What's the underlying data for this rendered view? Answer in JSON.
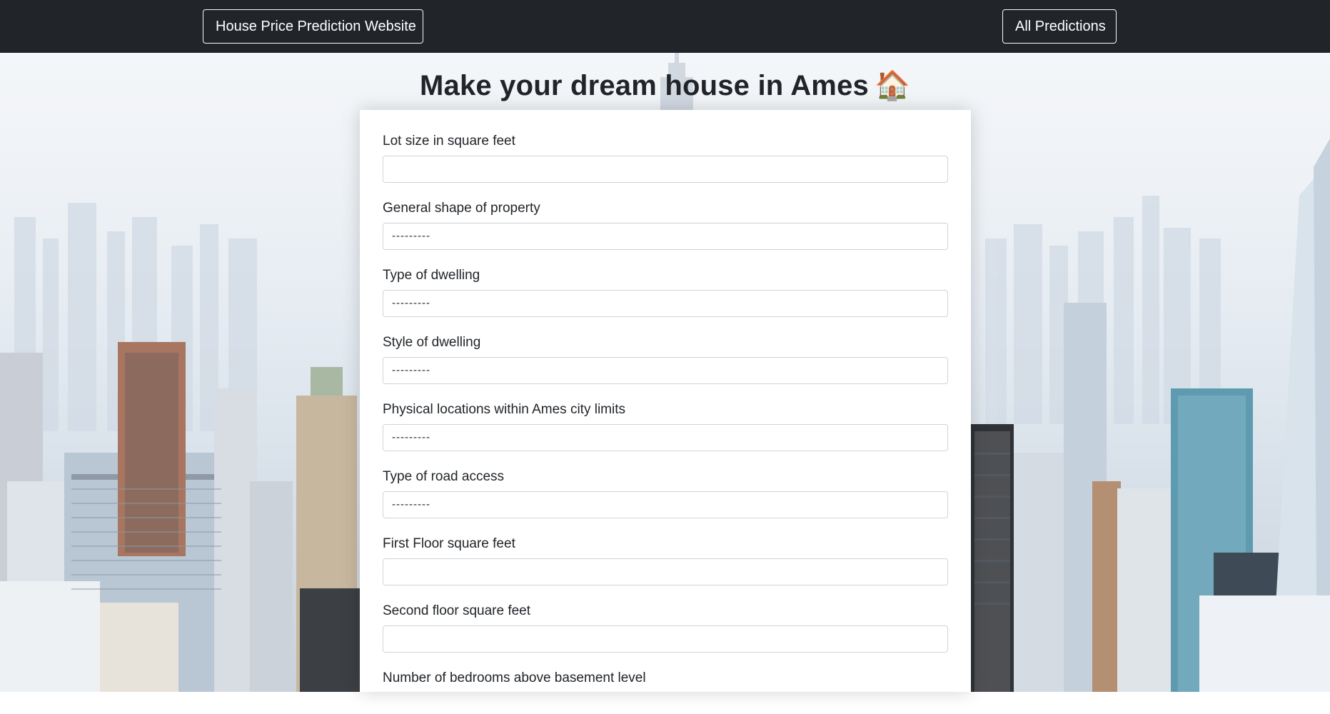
{
  "navbar": {
    "brand_label": "House Price Prediction Website",
    "predictions_label": "All Predictions"
  },
  "page": {
    "title": "Make your dream house in Ames",
    "title_emoji": "🏠"
  },
  "form": {
    "fields": [
      {
        "label": "Lot size in square feet",
        "type": "input",
        "value": ""
      },
      {
        "label": "General shape of property",
        "type": "select",
        "value": "---------"
      },
      {
        "label": "Type of dwelling",
        "type": "select",
        "value": "---------"
      },
      {
        "label": "Style of dwelling",
        "type": "select",
        "value": "---------"
      },
      {
        "label": "Physical locations within Ames city limits",
        "type": "select",
        "value": "---------"
      },
      {
        "label": "Type of road access",
        "type": "select",
        "value": "---------"
      },
      {
        "label": "First Floor square feet",
        "type": "input",
        "value": ""
      },
      {
        "label": "Second floor square feet",
        "type": "input",
        "value": ""
      },
      {
        "label": "Number of bedrooms above basement level",
        "type": "input",
        "value": ""
      }
    ]
  },
  "colors": {
    "navbar_bg": "#212529",
    "card_bg": "#ffffff",
    "input_border": "#ced4da"
  }
}
